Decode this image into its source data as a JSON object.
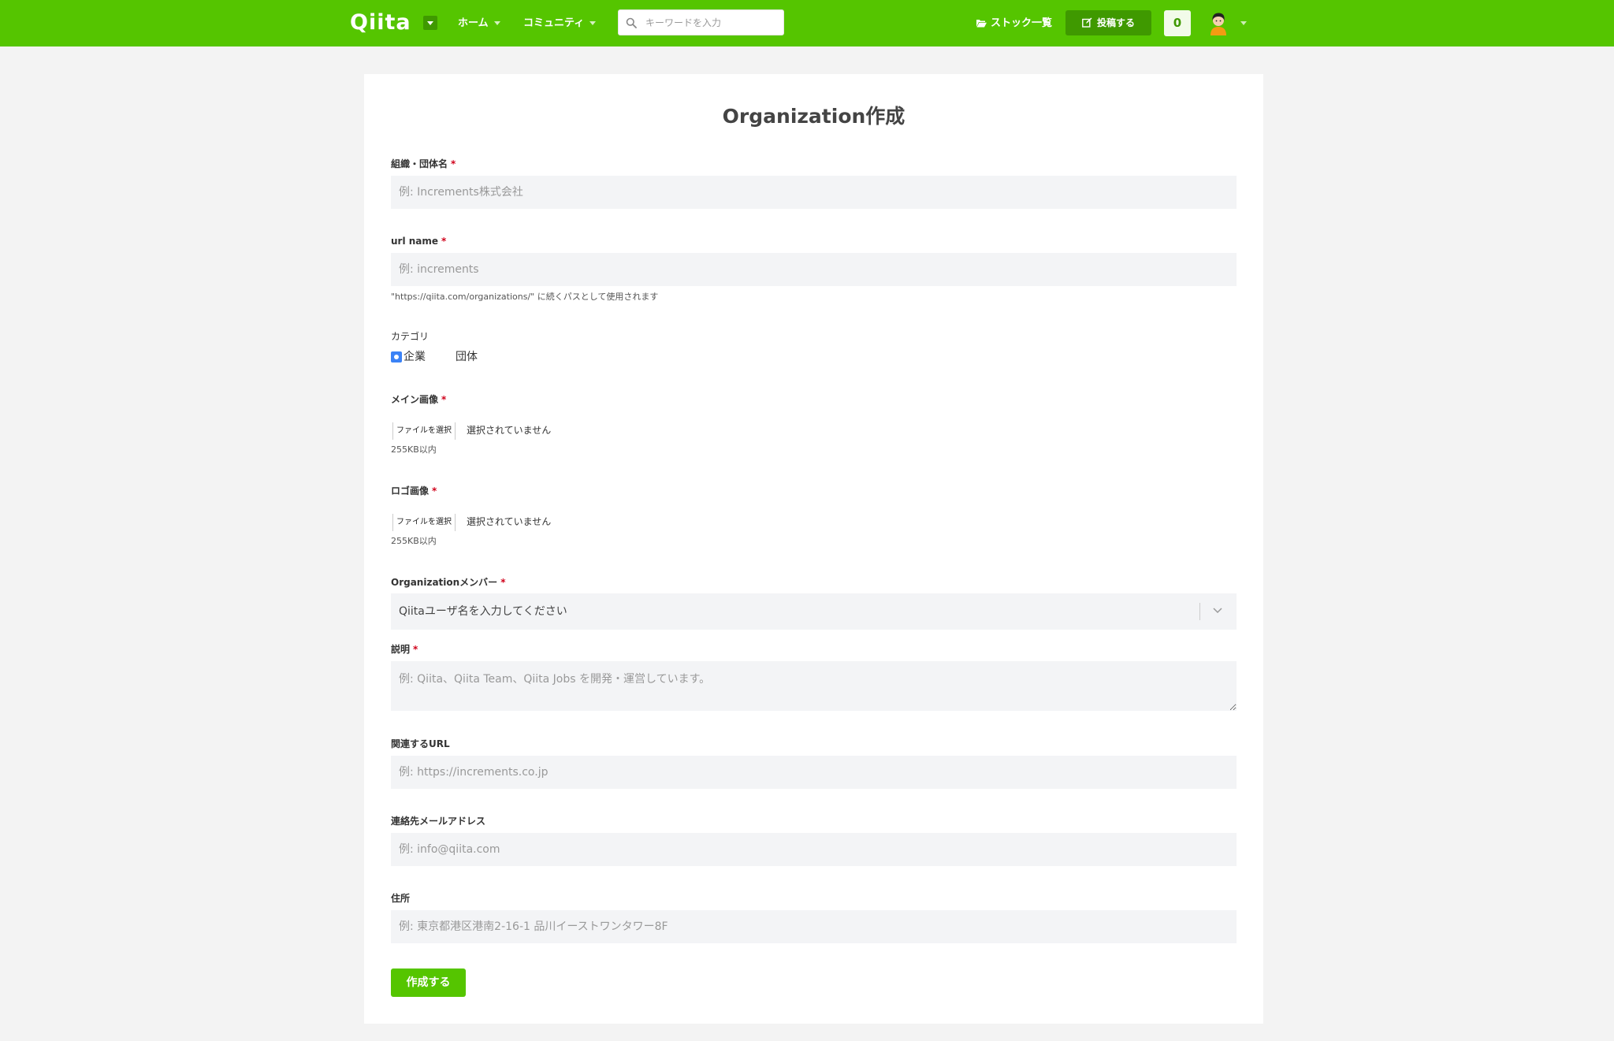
{
  "header": {
    "logo": "Qiita",
    "nav": [
      {
        "label": "ホーム"
      },
      {
        "label": "コミュニティ"
      }
    ],
    "search_placeholder": "キーワードを入力",
    "stock_label": "ストック一覧",
    "post_label": "投稿する",
    "notification_count": "0",
    "brand_color": "#55c500",
    "accent_dark": "#3f9900"
  },
  "form": {
    "title": "Organization作成",
    "required_mark": "*",
    "org_name": {
      "label": "組織・団体名",
      "placeholder": "例: Increments株式会社"
    },
    "url_name": {
      "label": "url name",
      "placeholder": "例: increments",
      "help": "\"https://qiita.com/organizations/\" に続くパスとして使用されます"
    },
    "category": {
      "label": "カテゴリ",
      "options": [
        "企業",
        "団体"
      ],
      "selected": "企業"
    },
    "main_image": {
      "label": "メイン画像",
      "button": "ファイルを選択",
      "status": "選択されていません",
      "help": "255KB以内"
    },
    "logo_image": {
      "label": "ロゴ画像",
      "button": "ファイルを選択",
      "status": "選択されていません",
      "help": "255KB以内"
    },
    "members": {
      "label": "Organizationメンバー",
      "placeholder": "Qiitaユーザ名を入力してください"
    },
    "description": {
      "label": "説明",
      "placeholder": "例: Qiita、Qiita Team、Qiita Jobs を開発・運営しています。"
    },
    "related_url": {
      "label": "関連するURL",
      "placeholder": "例: https://increments.co.jp"
    },
    "email": {
      "label": "連絡先メールアドレス",
      "placeholder": "例: info@qiita.com"
    },
    "address": {
      "label": "住所",
      "placeholder": "例: 東京都港区港南2-16-1 品川イーストワンタワー8F"
    },
    "submit_label": "作成する"
  }
}
